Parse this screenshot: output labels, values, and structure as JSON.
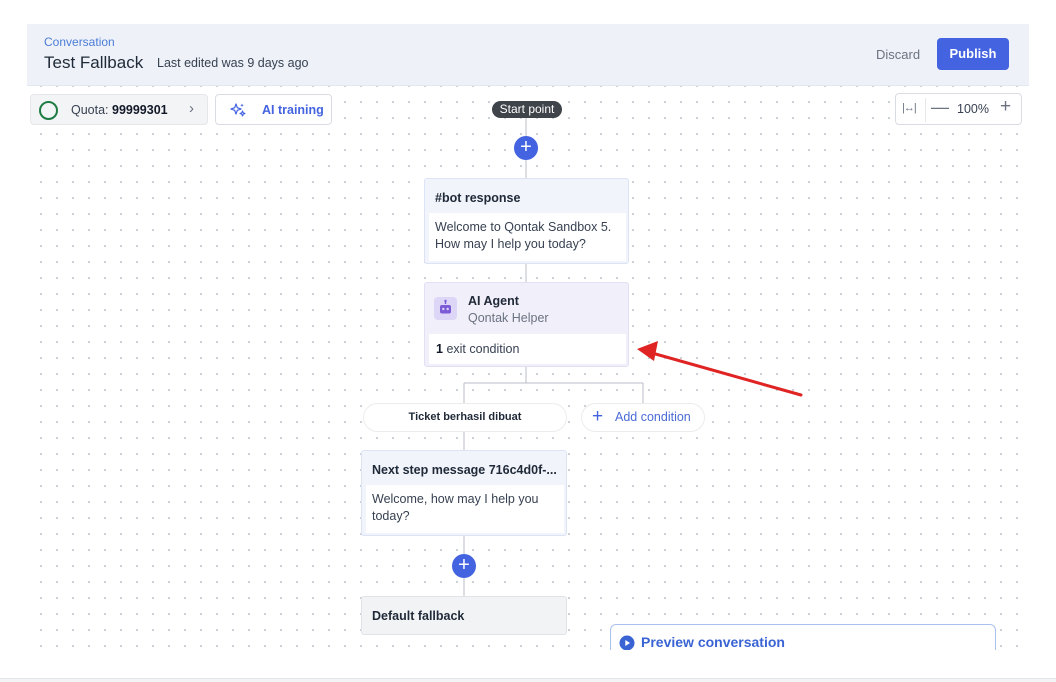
{
  "header": {
    "breadcrumb": "Conversation",
    "title": "Test Fallback",
    "subtitle": "Last edited was 9 days ago",
    "discard_label": "Discard",
    "publish_label": "Publish"
  },
  "toolbar": {
    "quota_prefix": "Quota: ",
    "quota_value": "99999301",
    "ai_training_label": "AI training",
    "zoom_level": "100%"
  },
  "flow": {
    "start_label": "Start point",
    "bot_response": {
      "title": "#bot response",
      "body": "Welcome to Qontak Sandbox 5. How may I help you today?"
    },
    "ai_agent": {
      "title": "AI Agent",
      "subtitle": "Qontak Helper",
      "exit_count": "1",
      "exit_label": "exit condition"
    },
    "condition_label": "Ticket berhasil dibuat",
    "add_condition_label": "Add condition",
    "next_step": {
      "title": "Next step message 716c4d0f-...",
      "body": "Welcome, how may I help you today?"
    },
    "fallback_label": "Default fallback"
  },
  "preview_label": "Preview conversation",
  "icons": [
    "chevron-right-icon",
    "sparkle-icon",
    "fit-width-icon",
    "minus-icon",
    "plus-icon",
    "robot-icon",
    "play-circle-icon"
  ],
  "colors": {
    "accent": "#4363e0",
    "annotation_arrow": "#e02424",
    "quota_ring": "#1e7c43"
  }
}
